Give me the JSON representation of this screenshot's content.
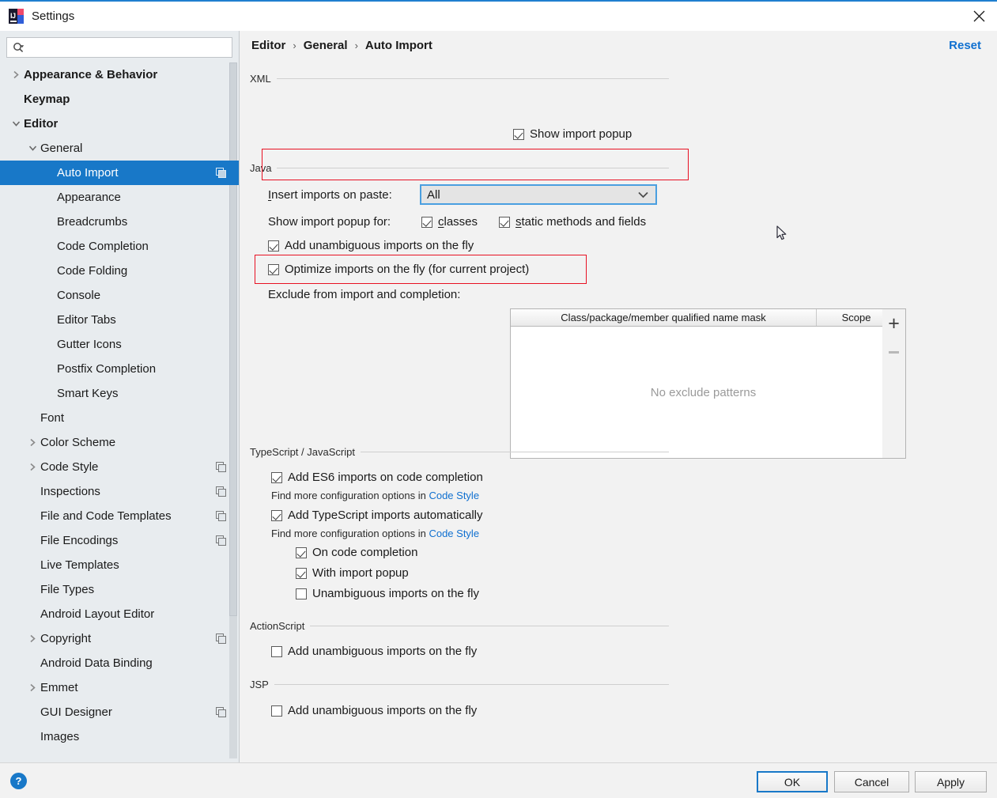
{
  "window": {
    "title": "Settings",
    "logo_icon": "intellij-idea-logo",
    "close_icon": "close-icon"
  },
  "sidebar": {
    "search": {
      "placeholder": "",
      "value": "",
      "icon": "search-icon",
      "dropdown_icon": "chevron-down-icon"
    },
    "items": [
      {
        "label": "Appearance & Behavior",
        "indent": 0,
        "arrow": "right",
        "bold": true,
        "selected": false,
        "scope_icon": false
      },
      {
        "label": "Keymap",
        "indent": 0,
        "arrow": "none",
        "bold": true,
        "selected": false,
        "scope_icon": false
      },
      {
        "label": "Editor",
        "indent": 0,
        "arrow": "down",
        "bold": true,
        "selected": false,
        "scope_icon": false
      },
      {
        "label": "General",
        "indent": 1,
        "arrow": "down",
        "bold": false,
        "selected": false,
        "scope_icon": false
      },
      {
        "label": "Auto Import",
        "indent": 2,
        "arrow": "none",
        "bold": false,
        "selected": true,
        "scope_icon": true
      },
      {
        "label": "Appearance",
        "indent": 2,
        "arrow": "none",
        "bold": false,
        "selected": false,
        "scope_icon": false
      },
      {
        "label": "Breadcrumbs",
        "indent": 2,
        "arrow": "none",
        "bold": false,
        "selected": false,
        "scope_icon": false
      },
      {
        "label": "Code Completion",
        "indent": 2,
        "arrow": "none",
        "bold": false,
        "selected": false,
        "scope_icon": false
      },
      {
        "label": "Code Folding",
        "indent": 2,
        "arrow": "none",
        "bold": false,
        "selected": false,
        "scope_icon": false
      },
      {
        "label": "Console",
        "indent": 2,
        "arrow": "none",
        "bold": false,
        "selected": false,
        "scope_icon": false
      },
      {
        "label": "Editor Tabs",
        "indent": 2,
        "arrow": "none",
        "bold": false,
        "selected": false,
        "scope_icon": false
      },
      {
        "label": "Gutter Icons",
        "indent": 2,
        "arrow": "none",
        "bold": false,
        "selected": false,
        "scope_icon": false
      },
      {
        "label": "Postfix Completion",
        "indent": 2,
        "arrow": "none",
        "bold": false,
        "selected": false,
        "scope_icon": false
      },
      {
        "label": "Smart Keys",
        "indent": 2,
        "arrow": "none",
        "bold": false,
        "selected": false,
        "scope_icon": false
      },
      {
        "label": "Font",
        "indent": 1,
        "arrow": "none",
        "bold": false,
        "selected": false,
        "scope_icon": false
      },
      {
        "label": "Color Scheme",
        "indent": 1,
        "arrow": "right",
        "bold": false,
        "selected": false,
        "scope_icon": false
      },
      {
        "label": "Code Style",
        "indent": 1,
        "arrow": "right",
        "bold": false,
        "selected": false,
        "scope_icon": true
      },
      {
        "label": "Inspections",
        "indent": 1,
        "arrow": "none",
        "bold": false,
        "selected": false,
        "scope_icon": true
      },
      {
        "label": "File and Code Templates",
        "indent": 1,
        "arrow": "none",
        "bold": false,
        "selected": false,
        "scope_icon": true
      },
      {
        "label": "File Encodings",
        "indent": 1,
        "arrow": "none",
        "bold": false,
        "selected": false,
        "scope_icon": true
      },
      {
        "label": "Live Templates",
        "indent": 1,
        "arrow": "none",
        "bold": false,
        "selected": false,
        "scope_icon": false
      },
      {
        "label": "File Types",
        "indent": 1,
        "arrow": "none",
        "bold": false,
        "selected": false,
        "scope_icon": false
      },
      {
        "label": "Android Layout Editor",
        "indent": 1,
        "arrow": "none",
        "bold": false,
        "selected": false,
        "scope_icon": false
      },
      {
        "label": "Copyright",
        "indent": 1,
        "arrow": "right",
        "bold": false,
        "selected": false,
        "scope_icon": true
      },
      {
        "label": "Android Data Binding",
        "indent": 1,
        "arrow": "none",
        "bold": false,
        "selected": false,
        "scope_icon": false
      },
      {
        "label": "Emmet",
        "indent": 1,
        "arrow": "right",
        "bold": false,
        "selected": false,
        "scope_icon": false
      },
      {
        "label": "GUI Designer",
        "indent": 1,
        "arrow": "none",
        "bold": false,
        "selected": false,
        "scope_icon": true
      },
      {
        "label": "Images",
        "indent": 1,
        "arrow": "none",
        "bold": false,
        "selected": false,
        "scope_icon": false
      }
    ]
  },
  "header": {
    "breadcrumb": [
      "Editor",
      "General",
      "Auto Import"
    ],
    "separator": "›",
    "reset_label": "Reset"
  },
  "sections": {
    "xml": {
      "title": "XML",
      "show_import_popup": {
        "label": "Show import popup",
        "checked": true
      }
    },
    "java": {
      "title": "Java",
      "insert_imports_label": "Insert imports on paste:",
      "insert_imports_mnemonic": "I",
      "insert_imports_value": "All",
      "show_import_popup_for_label": "Show import popup for:",
      "classes": {
        "label": "classes",
        "mnemonic": "c",
        "checked": true
      },
      "static_methods": {
        "label": "static methods and fields",
        "mnemonic": "s",
        "checked": true
      },
      "add_unambiguous": {
        "label": "Add unambiguous imports on the fly",
        "checked": true
      },
      "optimize_imports": {
        "label": "Optimize imports on the fly (for current project)",
        "checked": true
      },
      "exclude_label": "Exclude from import and completion:",
      "table": {
        "columns": [
          "Class/package/member qualified name mask",
          "Scope"
        ],
        "rows": [],
        "empty_text": "No exclude patterns",
        "add_button": "+",
        "remove_button": "−"
      }
    },
    "ts_js": {
      "title": "TypeScript / JavaScript",
      "add_es6": {
        "label": "Add ES6 imports on code completion",
        "checked": true
      },
      "hint1_prefix": "Find more configuration options in ",
      "hint1_link": "Code Style",
      "add_ts": {
        "label": "Add TypeScript imports automatically",
        "checked": true
      },
      "hint2_prefix": "Find more configuration options in ",
      "hint2_link": "Code Style",
      "on_code_completion": {
        "label": "On code completion",
        "checked": true
      },
      "with_import_popup": {
        "label": "With import popup",
        "checked": true
      },
      "unambiguous_fly": {
        "label": "Unambiguous imports on the fly",
        "checked": false
      }
    },
    "actionscript": {
      "title": "ActionScript",
      "add_unambiguous": {
        "label": "Add unambiguous imports on the fly",
        "checked": false
      }
    },
    "jsp": {
      "title": "JSP",
      "add_unambiguous": {
        "label": "Add unambiguous imports on the fly",
        "checked": false
      }
    }
  },
  "footer": {
    "help_label": "?",
    "ok_label": "OK",
    "cancel_label": "Cancel",
    "apply_label": "Apply"
  },
  "colors": {
    "accent_blue": "#1878c8",
    "link_blue": "#1070d0",
    "annotation_red": "#e81123",
    "sidebar_bg": "#e8ecef",
    "content_bg": "#f2f2f2"
  }
}
